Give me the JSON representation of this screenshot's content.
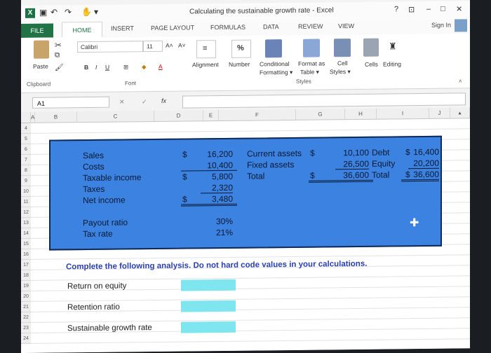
{
  "window": {
    "title": "Calculating the sustainable growth rate - Excel",
    "help": "?",
    "controls": [
      "–",
      "□",
      "✕"
    ]
  },
  "tabs": {
    "file": "FILE",
    "items": [
      "HOME",
      "INSERT",
      "PAGE LAYOUT",
      "FORMULAS",
      "DATA",
      "REVIEW",
      "VIEW"
    ],
    "sign_in": "Sign In"
  },
  "ribbon": {
    "font_name": "Calibri",
    "font_size": "11",
    "grow": "A˄",
    "shrink": "A˅",
    "paste": "Paste",
    "bold": "B",
    "italic": "I",
    "underline": "U",
    "alignment": "Alignment",
    "number": "Number",
    "percent": "%",
    "conditional": "Conditional",
    "formatting": "Formatting ▾",
    "format_as": "Format as",
    "table": "Table ▾",
    "cell": "Cell",
    "styles": "Styles ▾",
    "cells": "Cells",
    "editing": "Editing",
    "groups": {
      "clipboard": "Clipboard",
      "font": "Font",
      "styles": "Styles"
    }
  },
  "formula_bar": {
    "name_box": "A1",
    "fx": "fx",
    "formula": ""
  },
  "columns": [
    "A",
    "B",
    "C",
    "D",
    "E",
    "F",
    "G",
    "H",
    "I",
    "J"
  ],
  "rows": [
    "4",
    "5",
    "6",
    "7",
    "8",
    "9",
    "10",
    "11",
    "12",
    "13",
    "14",
    "15",
    "16",
    "17",
    "18",
    "19",
    "20",
    "21",
    "22",
    "23",
    "24"
  ],
  "income": {
    "labels": [
      "Sales",
      "Costs",
      "Taxable income",
      "Taxes",
      "Net income"
    ],
    "currency": "$",
    "values": [
      "16,200",
      "10,400",
      "5,800",
      "2,320",
      "3,480"
    ]
  },
  "balance": {
    "assets_labels": [
      "Current assets",
      "Fixed assets",
      "Total"
    ],
    "assets_values": [
      "10,100",
      "26,500",
      "36,600"
    ],
    "claims_labels": [
      "Debt",
      "Equity",
      "Total"
    ],
    "claims_values": [
      "16,400",
      "20,200",
      "36,600"
    ]
  },
  "ratios": {
    "labels": [
      "Payout ratio",
      "Tax rate"
    ],
    "values": [
      "30%",
      "21%"
    ]
  },
  "instructions": "Complete the following analysis. Do not hard code values in your calculations.",
  "analysis": [
    "Return on equity",
    "Retention ratio",
    "Sustainable growth rate"
  ]
}
